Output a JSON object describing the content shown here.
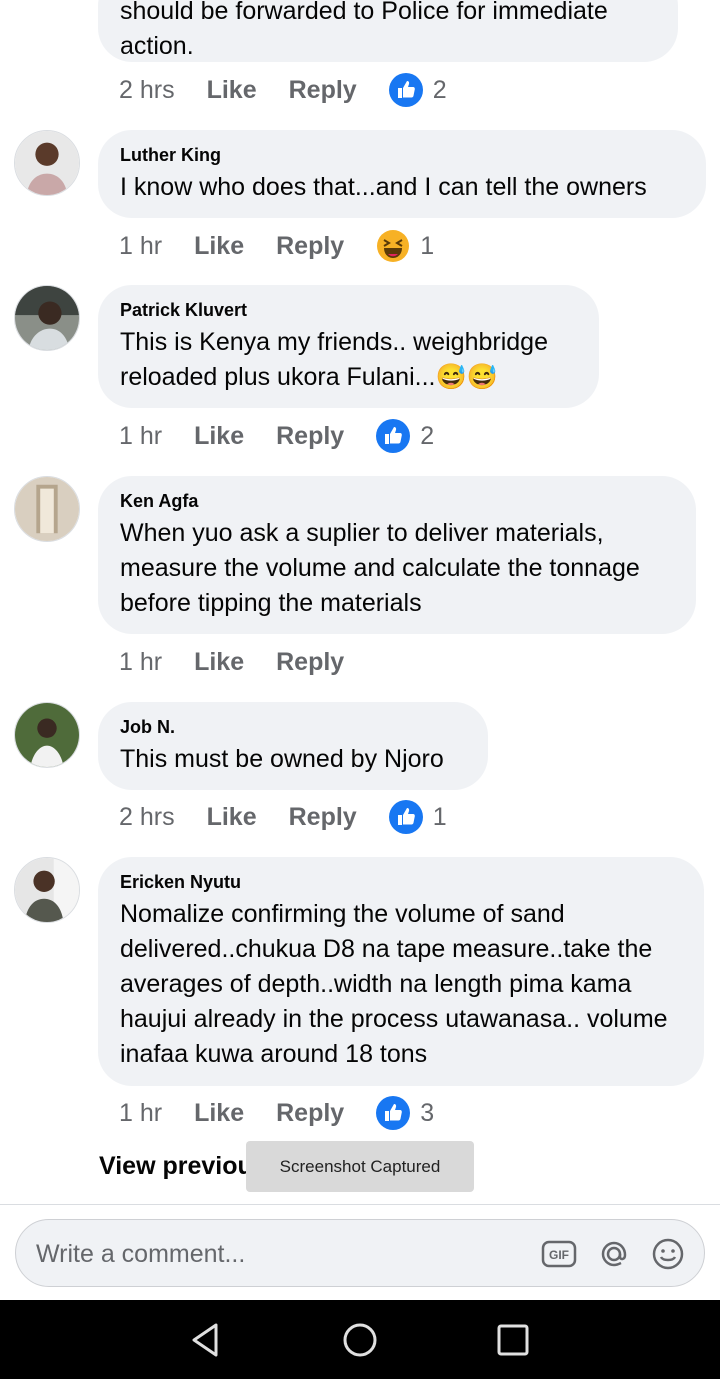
{
  "comments": [
    {
      "author": "",
      "text": "should be forwarded to Police for immediate action.",
      "time": "2 hrs",
      "like_label": "Like",
      "reply_label": "Reply",
      "reaction_icon": "thumbs-up-icon",
      "reaction_count": "2"
    },
    {
      "author": "Luther King",
      "text": "I know who does that...and I can tell the owners",
      "time": "1 hr",
      "like_label": "Like",
      "reply_label": "Reply",
      "reaction_icon": "haha-emoji-icon",
      "reaction_count": "1"
    },
    {
      "author": "Patrick Kluvert",
      "text": "This is Kenya my friends.. weighbridge reloaded plus ukora Fulani...😅😅",
      "time": "1 hr",
      "like_label": "Like",
      "reply_label": "Reply",
      "reaction_icon": "thumbs-up-icon",
      "reaction_count": "2"
    },
    {
      "author": "Ken Agfa",
      "text": "When yuo ask a suplier to deliver materials, measure the volume and calculate the tonnage before tipping the materials",
      "time": "1 hr",
      "like_label": "Like",
      "reply_label": "Reply"
    },
    {
      "author": "Job N.",
      "text": "This must be owned by Njoro",
      "time": "2 hrs",
      "like_label": "Like",
      "reply_label": "Reply",
      "reaction_icon": "thumbs-up-icon",
      "reaction_count": "1"
    },
    {
      "author": "Ericken Nyutu",
      "text": "Nomalize confirming the volume of sand delivered..chukua D8 na tape measure..take the averages of depth..width na  length pima kama haujui already in the process utawanasa.. volume inafaa kuwa around 18 tons",
      "time": "1 hr",
      "like_label": "Like",
      "reply_label": "Reply",
      "reaction_icon": "thumbs-up-icon",
      "reaction_count": "3"
    }
  ],
  "view_previous": "View previous reply",
  "toast": "Screenshot Captured",
  "composer": {
    "placeholder": "Write a comment...",
    "icons": [
      "gif-icon",
      "mention-icon",
      "emoji-icon"
    ]
  },
  "navbar": {
    "icons": [
      "back-icon",
      "home-icon",
      "recents-icon"
    ]
  },
  "colors": {
    "like_blue": "#1877f2",
    "bubble_bg": "#f0f2f5",
    "meta_gray": "#65676b"
  }
}
